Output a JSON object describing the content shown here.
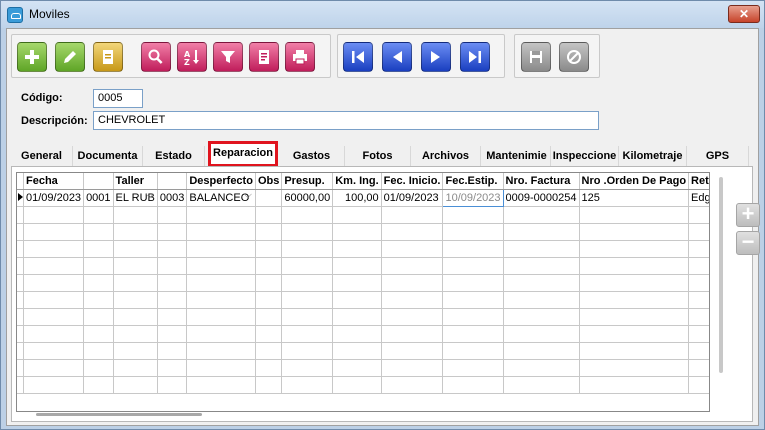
{
  "window": {
    "title": "Moviles",
    "close_label": "✕"
  },
  "toolbar": {
    "buttons": [
      {
        "icon": "plus-icon",
        "color": "#6cbf2f"
      },
      {
        "icon": "pencil-icon",
        "color": "#6cbf2f"
      },
      {
        "icon": "document-icon",
        "color": "#d8a81c"
      },
      {
        "icon": "search-icon",
        "color": "#d8185e"
      },
      {
        "icon": "sort-az-icon",
        "color": "#d8185e"
      },
      {
        "icon": "filter-icon",
        "color": "#d8185e"
      },
      {
        "icon": "report-icon",
        "color": "#d8185e"
      },
      {
        "icon": "print-icon",
        "color": "#d8185e"
      },
      {
        "icon": "first-record-icon",
        "color": "#1f4ed8"
      },
      {
        "icon": "previous-record-icon",
        "color": "#1f4ed8"
      },
      {
        "icon": "next-record-icon",
        "color": "#1f4ed8"
      },
      {
        "icon": "last-record-icon",
        "color": "#1f4ed8"
      },
      {
        "icon": "save-icon",
        "color": "#9a9a9a"
      },
      {
        "icon": "cancel-icon",
        "color": "#9a9a9a"
      }
    ]
  },
  "form": {
    "codigo_label": "Código:",
    "codigo_value": "0005",
    "descripcion_label": "Descripción:",
    "descripcion_value": "CHEVROLET"
  },
  "tabs": [
    "General",
    "Documenta",
    "Estado",
    "Reparacion",
    "Gastos",
    "Fotos",
    "Archivos",
    "Mantenimie",
    "Inspeccione",
    "Kilometraje",
    "GPS"
  ],
  "grid": {
    "columns": [
      "Fecha",
      "",
      "Taller",
      "",
      "Desperfecto",
      "Obs",
      "Presup.",
      "Km. Ing.",
      "Fec. Inicio.",
      "Fec.Estip.",
      "Nro. Factura",
      "Nro .Orden De Pago",
      "Retir"
    ],
    "rows": [
      [
        "01/09/2023",
        "0001",
        "EL RUB",
        "0003",
        "BALANCEO",
        "",
        "60000,00",
        "100,00",
        "01/09/2023",
        "10/09/2023",
        "0009-0000254",
        "125",
        "Edga"
      ]
    ]
  },
  "side_buttons": {
    "add": "+",
    "remove": "−"
  }
}
